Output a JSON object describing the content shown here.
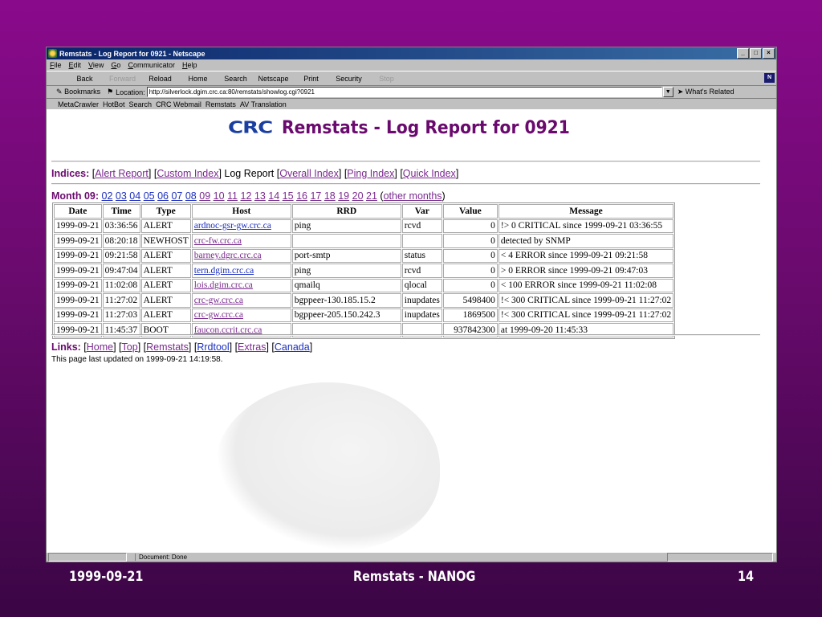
{
  "window": {
    "title": "Remstats - Log Report for 0921 - Netscape",
    "controls": [
      "_",
      "□",
      "×"
    ]
  },
  "menu": [
    "File",
    "Edit",
    "View",
    "Go",
    "Communicator",
    "Help"
  ],
  "nav": {
    "buttons": [
      {
        "label": "Back",
        "enabled": true
      },
      {
        "label": "Forward",
        "enabled": false
      },
      {
        "label": "Reload",
        "enabled": true
      },
      {
        "label": "Home",
        "enabled": true
      },
      {
        "label": "Search",
        "enabled": true
      },
      {
        "label": "Netscape",
        "enabled": true
      },
      {
        "label": "Print",
        "enabled": true
      },
      {
        "label": "Security",
        "enabled": true
      },
      {
        "label": "Stop",
        "enabled": false
      }
    ],
    "throbber": "N"
  },
  "location": {
    "bookmarks_label": "Bookmarks",
    "label": "Location:",
    "url": "http://silverlock.dgim.crc.ca:80/remstats/showlog.cgi?0921",
    "related_label": "What's Related"
  },
  "personal_bar": [
    "MetaCrawler",
    "HotBot",
    "Search",
    "CRC Webmail",
    "Remstats",
    "AV Translation"
  ],
  "page": {
    "logo": "CRC",
    "title": "Remstats - Log Report for 0921",
    "indices": {
      "label": "Indices:",
      "items": [
        {
          "text": "Alert Report",
          "link": true
        },
        {
          "text": "Custom Index",
          "link": true
        },
        {
          "text": "Log Report",
          "link": false
        },
        {
          "text": "Overall Index",
          "link": true
        },
        {
          "text": "Ping Index",
          "link": true
        },
        {
          "text": "Quick Index",
          "link": true
        }
      ]
    },
    "month": {
      "label": "Month 09:",
      "days": [
        "02",
        "03",
        "04",
        "05",
        "06",
        "07",
        "08",
        "09",
        "10",
        "11",
        "12",
        "13",
        "14",
        "15",
        "16",
        "17",
        "18",
        "19",
        "20",
        "21"
      ],
      "other": "other months"
    },
    "table": {
      "headers": [
        "Date",
        "Time",
        "Type",
        "Host",
        "RRD",
        "Var",
        "Value",
        "Message"
      ],
      "rows": [
        [
          "1999-09-21",
          "03:36:56",
          "ALERT",
          "ardnoc-gsr-gw.crc.ca",
          "ping",
          "rcvd",
          "0",
          "!> 0 CRITICAL since 1999-09-21 03:36:55"
        ],
        [
          "1999-09-21",
          "08:20:18",
          "NEWHOST",
          "crc-fw.crc.ca",
          "",
          "",
          "0",
          "detected by SNMP"
        ],
        [
          "1999-09-21",
          "09:21:58",
          "ALERT",
          "barney.dgrc.crc.ca",
          "port-smtp",
          "status",
          "0",
          "< 4 ERROR since 1999-09-21 09:21:58"
        ],
        [
          "1999-09-21",
          "09:47:04",
          "ALERT",
          "tern.dgim.crc.ca",
          "ping",
          "rcvd",
          "0",
          "> 0 ERROR since 1999-09-21 09:47:03"
        ],
        [
          "1999-09-21",
          "11:02:08",
          "ALERT",
          "lois.dgim.crc.ca",
          "qmailq",
          "qlocal",
          "0",
          "< 100 ERROR since 1999-09-21 11:02:08"
        ],
        [
          "1999-09-21",
          "11:27:02",
          "ALERT",
          "crc-gw.crc.ca",
          "bgppeer-130.185.15.2",
          "inupdates",
          "5498400",
          "!< 300 CRITICAL since 1999-09-21 11:27:02"
        ],
        [
          "1999-09-21",
          "11:27:03",
          "ALERT",
          "crc-gw.crc.ca",
          "bgppeer-205.150.242.3",
          "inupdates",
          "1869500",
          "!< 300 CRITICAL since 1999-09-21 11:27:02"
        ],
        [
          "1999-09-21",
          "11:45:37",
          "BOOT",
          "faucon.ccrit.crc.ca",
          "",
          "",
          "937842300",
          "at 1999-09-20 11:45:33"
        ]
      ]
    },
    "links": {
      "label": "Links:",
      "items": [
        "Home",
        "Top",
        "Remstats",
        "Rrdtool",
        "Extras",
        "Canada"
      ]
    },
    "updated": "This page last updated on 1999-09-21 14:19:58."
  },
  "statusbar": {
    "text": "Document: Done"
  },
  "footer": {
    "date": "1999-09-21",
    "title": "Remstats - NANOG",
    "slide": "14"
  },
  "colors": {
    "accent": "#6a0a6e",
    "link": "#1c2fbf",
    "visited": "#7a2a8e",
    "titlebar": "#0a246a"
  }
}
